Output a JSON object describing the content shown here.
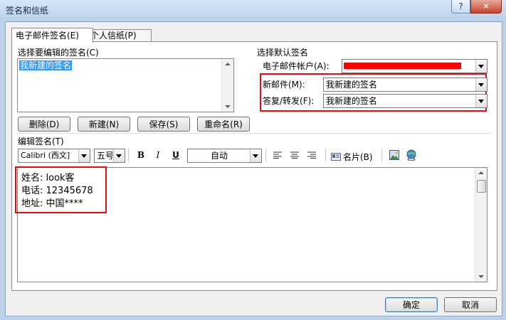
{
  "window": {
    "title": "签名和信纸",
    "help_label": "?",
    "close_label": "✕"
  },
  "tabs": [
    {
      "label": "电子邮件签名(E)",
      "active": true
    },
    {
      "label": "个人信纸(P)",
      "active": false
    }
  ],
  "select_signature": {
    "label": "选择要编辑的签名(C)",
    "items": [
      "我新建的签名"
    ],
    "selected_index": 0
  },
  "buttons": {
    "delete": "删除(D)",
    "new": "新建(N)",
    "save": "保存(S)",
    "rename": "重命名(R)"
  },
  "default_signature": {
    "section_label": "选择默认签名",
    "account_label": "电子邮件帐户(A):",
    "account_value_redacted": true,
    "new_messages_label": "新邮件(M):",
    "new_messages_value": "我新建的签名",
    "replies_label": "答复/转发(F):",
    "replies_value": "我新建的签名"
  },
  "edit_signature": {
    "label": "编辑签名(T)",
    "font_name": "Calibri (西文]",
    "font_size": "五号",
    "color": "自动",
    "bold_label": "B",
    "italic_label": "I",
    "underline_label": "U",
    "business_card_label": "名片(B)",
    "lines": [
      "姓名: look客",
      "电话: 12345678",
      "地址: 中国****"
    ]
  },
  "dialog_buttons": {
    "ok": "确定",
    "cancel": "取消"
  },
  "colors": {
    "highlight": "#e01010",
    "selection": "#3399ff",
    "frame": "#bcd1ea"
  },
  "icons": [
    "help-icon",
    "close-icon",
    "bold-icon",
    "italic-icon",
    "underline-icon",
    "align-left-icon",
    "align-center-icon",
    "align-right-icon",
    "business-card-icon",
    "insert-picture-icon",
    "hyperlink-icon"
  ]
}
